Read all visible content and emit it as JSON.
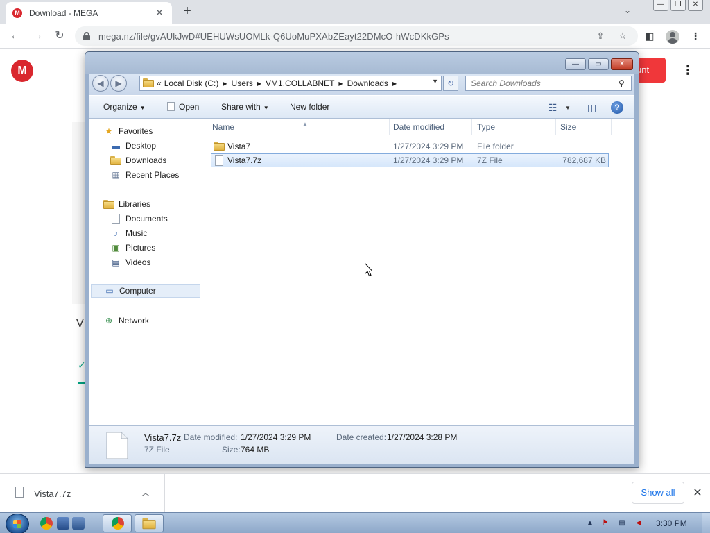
{
  "browser": {
    "tab_title": "Download - MEGA",
    "favicon_letter": "M",
    "url": "mega.nz/file/gvAUkJwD#UEHUWsUOMLk-Q6UoMuPXAbZEayt22DMcO-hWcDKkGPs"
  },
  "mega": {
    "logo_letter": "M",
    "account_button_fragment": "unt",
    "heading_fragment": "V"
  },
  "dialog": {
    "breadcrumbs": [
      "Local Disk (C:)",
      "Users",
      "VM1.COLLABNET",
      "Downloads"
    ],
    "breadcrumb_prefix": "«",
    "search_placeholder": "Search Downloads",
    "commands": {
      "organize": "Organize",
      "open": "Open",
      "share_with": "Share with",
      "new_folder": "New folder"
    },
    "nav": {
      "favorites": "Favorites",
      "desktop": "Desktop",
      "downloads": "Downloads",
      "recent_places": "Recent Places",
      "libraries": "Libraries",
      "documents": "Documents",
      "music": "Music",
      "pictures": "Pictures",
      "videos": "Videos",
      "computer": "Computer",
      "network": "Network"
    },
    "columns": {
      "name": "Name",
      "date_modified": "Date modified",
      "type": "Type",
      "size": "Size"
    },
    "files": [
      {
        "name": "Vista7",
        "date": "1/27/2024 3:29 PM",
        "type": "File folder",
        "size": ""
      },
      {
        "name": "Vista7.7z",
        "date": "1/27/2024 3:29 PM",
        "type": "7Z File",
        "size": "782,687 KB"
      }
    ],
    "details": {
      "name": "Vista7.7z",
      "type": "7Z File",
      "modified_label": "Date modified:",
      "modified_value": "1/27/2024 3:29 PM",
      "created_label": "Date created:",
      "created_value": "1/27/2024 3:28 PM",
      "size_label": "Size:",
      "size_value": "764 MB"
    }
  },
  "download_bar": {
    "file_name": "Vista7.7z",
    "show_all": "Show all"
  },
  "taskbar": {
    "clock": "3:30 PM"
  },
  "colors": {
    "mega_red": "#d9272e",
    "selection_border": "#84acdd",
    "link_blue": "#1a73e8"
  }
}
